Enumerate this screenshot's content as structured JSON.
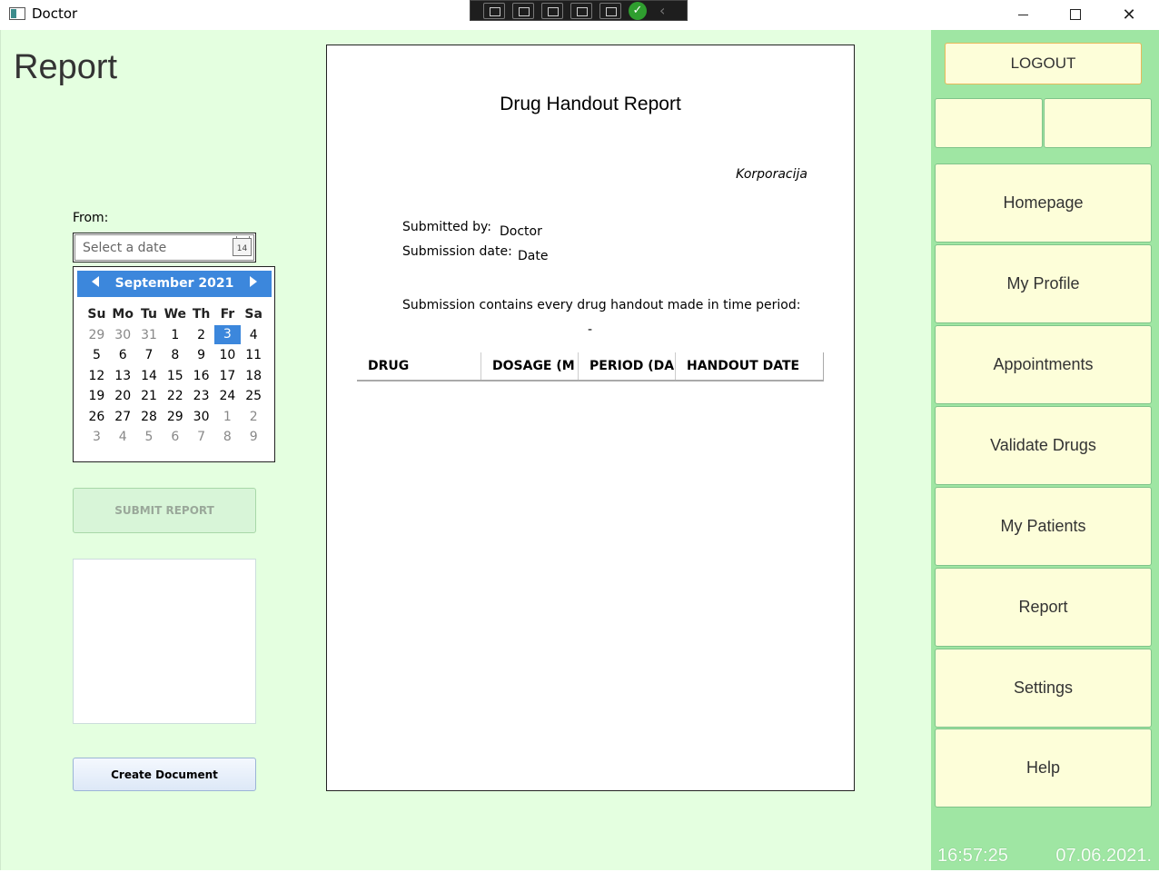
{
  "window": {
    "title": "Doctor"
  },
  "page": {
    "title": "Report"
  },
  "form": {
    "from_label": "From:",
    "date_placeholder": "Select a date",
    "calendar_icon_text": "14",
    "submit_label": "SUBMIT REPORT",
    "create_label": "Create Document"
  },
  "calendar": {
    "month_label": "September 2021",
    "weekdays": [
      "Su",
      "Mo",
      "Tu",
      "We",
      "Th",
      "Fr",
      "Sa"
    ],
    "selected_day": "3",
    "weeks": [
      [
        "29",
        "30",
        "31",
        "1",
        "2",
        "3",
        "4"
      ],
      [
        "5",
        "6",
        "7",
        "8",
        "9",
        "10",
        "11"
      ],
      [
        "12",
        "13",
        "14",
        "15",
        "16",
        "17",
        "18"
      ],
      [
        "19",
        "20",
        "21",
        "22",
        "23",
        "24",
        "25"
      ],
      [
        "26",
        "27",
        "28",
        "29",
        "30",
        "1",
        "2"
      ],
      [
        "3",
        "4",
        "5",
        "6",
        "7",
        "8",
        "9"
      ]
    ]
  },
  "document": {
    "title": "Drug Handout Report",
    "company": "Korporacija",
    "submitted_by_label": "Submitted by:",
    "submitted_by_value": "Doctor",
    "submission_date_label": "Submission date:",
    "submission_date_value": "Date",
    "period_text": "Submission contains every drug handout made in time period:",
    "period_value": "-",
    "columns": [
      "DRUG",
      "DOSAGE (M",
      "PERIOD (DA",
      "HANDOUT DATE"
    ]
  },
  "sidebar": {
    "logout_label": "LOGOUT",
    "nav": [
      "Homepage",
      "My Profile",
      "Appointments",
      "Validate Drugs",
      "My Patients",
      "Report",
      "Settings",
      "Help"
    ]
  },
  "status": {
    "time": "16:57:25",
    "date": "07.06.2021."
  },
  "colors": {
    "main_bg": "#e4ffe0",
    "sidebar_bg": "#9fe6a3",
    "button_bg": "#fdfed9",
    "calendar_accent": "#3c87dc"
  }
}
